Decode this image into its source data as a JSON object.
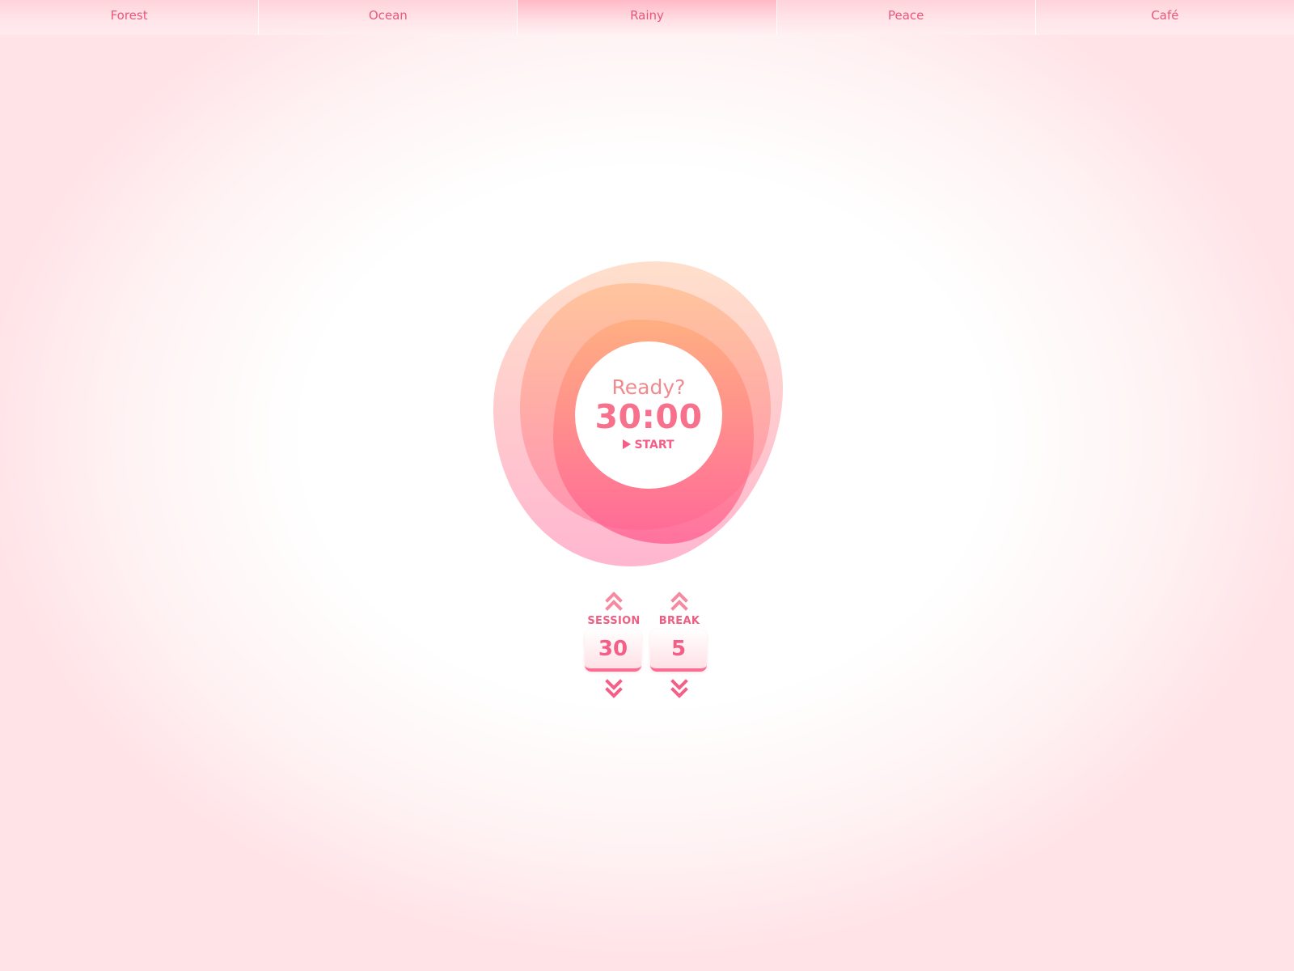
{
  "tabs": [
    {
      "label": "Forest"
    },
    {
      "label": "Ocean"
    },
    {
      "label": "Rainy"
    },
    {
      "label": "Peace"
    },
    {
      "label": "Café"
    }
  ],
  "active_tab": "Rainy",
  "timer": {
    "status": "Ready?",
    "time": "30:00",
    "start_label": "START"
  },
  "session": {
    "label": "SESSION",
    "value": "30"
  },
  "break": {
    "label": "BREAK",
    "value": "5"
  },
  "colors": {
    "accent": "#f55e86",
    "text_pink": "#e8587a",
    "blob_orange": "#ffb07a",
    "blob_pink": "#ff5f92"
  }
}
